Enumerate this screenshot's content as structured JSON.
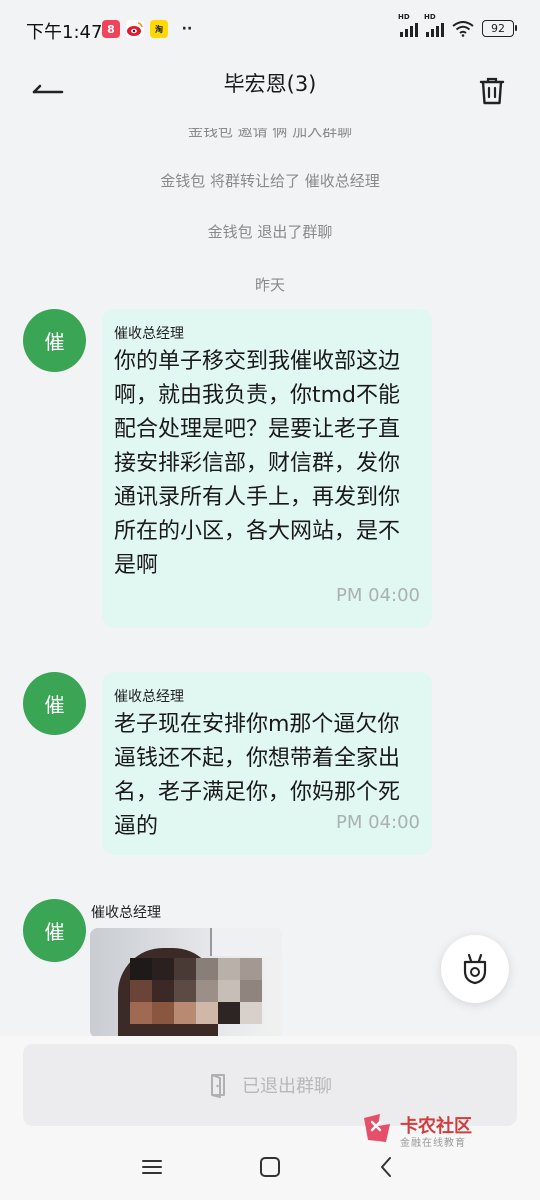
{
  "status": {
    "time": "下午1:47",
    "battery": "92"
  },
  "header": {
    "title": "毕宏恩(3)"
  },
  "chat": {
    "system_cut": "金钱包 邀请 俩 加入群聊",
    "system1": "金钱包 将群转让给了 催收总经理",
    "system2": "金钱包 退出了群聊",
    "date_label": "昨天",
    "messages": [
      {
        "avatar_char": "催",
        "sender": "催收总经理",
        "text": "你的单子移交到我催收部这边啊，就由我负责，你tmd不能配合处理是吧？是要让老子直接安排彩信部，财信群，发你通讯录所有人手上，再发到你所在的小区，各大网站，是不是啊",
        "time": "PM 04:00"
      },
      {
        "avatar_char": "催",
        "sender": "催收总经理",
        "text": "老子现在安排你m那个逼欠你逼钱还不起，你想带着全家出名，老子满足你，你妈那个死逼的",
        "time": "PM 04:00"
      },
      {
        "avatar_char": "催",
        "sender": "催收总经理"
      }
    ]
  },
  "bottom": {
    "exit_label": "已退出群聊"
  },
  "watermark": {
    "main": "卡农社区",
    "sub": "金融在线教育"
  },
  "colors": {
    "avatar": "#3aa655",
    "bubble": "#e1f7f1",
    "background": "#f2f3f5"
  }
}
